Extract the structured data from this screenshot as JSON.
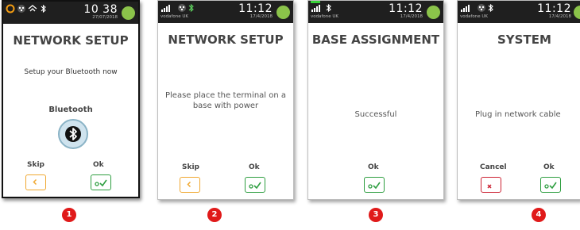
{
  "screens": [
    {
      "time": "10 38",
      "date": "27/07/2018",
      "battery": "",
      "title": "NETWORK SETUP",
      "subtitle": "Setup your Bluetooth now",
      "bluetooth_label": "Bluetooth",
      "skip_label": "Skip",
      "ok_label": "Ok"
    },
    {
      "carrier": "vodafone UK",
      "time": "11:12",
      "date": "17/4/2018",
      "battery": "",
      "title": "NETWORK SETUP",
      "message": "Please place the terminal on a base with power",
      "skip_label": "Skip",
      "ok_label": "Ok"
    },
    {
      "carrier": "vodafone UK",
      "time": "11:12",
      "date": "17/4/2018",
      "battery": "",
      "title": "BASE ASSIGNMENT",
      "message": "Successful",
      "ok_label": "Ok"
    },
    {
      "carrier": "vodafone UK",
      "time": "11:12",
      "date": "17/4/2018",
      "battery": "",
      "title": "SYSTEM",
      "message": "Plug in network cable",
      "cancel_label": "Cancel",
      "ok_label": "Ok"
    }
  ],
  "steps": [
    "1",
    "2",
    "3",
    "4"
  ],
  "colors": {
    "skip": "#f0a830",
    "ok": "#2e9e40",
    "cancel": "#cc2233",
    "step_badge": "#e01a1a"
  }
}
